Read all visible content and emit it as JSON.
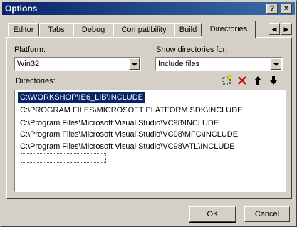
{
  "window": {
    "title": "Options",
    "help_label": "?",
    "close_label": "×"
  },
  "tabs": [
    {
      "label": "Editor"
    },
    {
      "label": "Tabs"
    },
    {
      "label": "Debug"
    },
    {
      "label": "Compatibility"
    },
    {
      "label": "Build"
    },
    {
      "label": "Directories",
      "active": true
    }
  ],
  "tab_scroll": {
    "left": "◀",
    "right": "▶"
  },
  "platform": {
    "label": "Platform:",
    "value": "Win32"
  },
  "show_dirs": {
    "label": "Show directories for:",
    "value": "Include files"
  },
  "directories": {
    "label": "Directories:",
    "items": [
      "C:\\WORKSHOP\\IE6_LIB\\INCLUDE",
      "C:\\PROGRAM FILES\\MICROSOFT PLATFORM SDK\\INCLUDE",
      "C:\\Program Files\\Microsoft Visual Studio\\VC98\\INCLUDE",
      "C:\\Program Files\\Microsoft Visual Studio\\VC98\\MFC\\INCLUDE",
      "C:\\Program Files\\Microsoft Visual Studio\\VC98\\ATL\\INCLUDE"
    ],
    "selected_index": 0
  },
  "buttons": {
    "ok": "OK",
    "cancel": "Cancel"
  },
  "colors": {
    "titlebar": "#0a246a",
    "selection": "#0a246a",
    "face": "#d4d0c8",
    "delete": "#cc0000"
  }
}
